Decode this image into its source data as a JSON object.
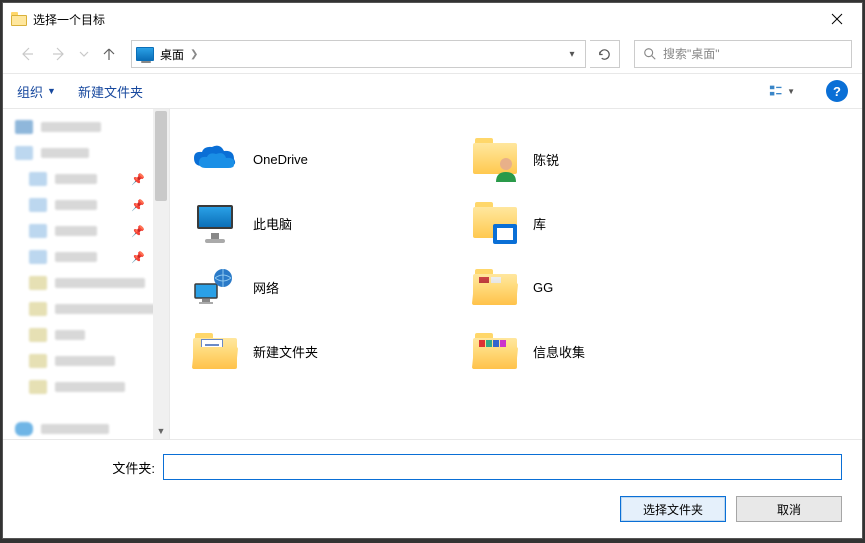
{
  "title": "选择一个目标",
  "nav": {
    "address_crumb": "桌面",
    "search_placeholder": "搜索\"桌面\""
  },
  "toolbar": {
    "org": "组织",
    "newfolder": "新建文件夹"
  },
  "items": [
    {
      "label": "OneDrive",
      "icon": "onedrive"
    },
    {
      "label": "陈锐",
      "icon": "user"
    },
    {
      "label": "此电脑",
      "icon": "pc"
    },
    {
      "label": "库",
      "icon": "lib"
    },
    {
      "label": "网络",
      "icon": "net"
    },
    {
      "label": "GG",
      "icon": "folder-open"
    },
    {
      "label": "新建文件夹",
      "icon": "folder-doc"
    },
    {
      "label": "信息收集",
      "icon": "folder-color"
    }
  ],
  "footer": {
    "label": "文件夹:",
    "value": "",
    "ok": "选择文件夹",
    "cancel": "取消"
  }
}
